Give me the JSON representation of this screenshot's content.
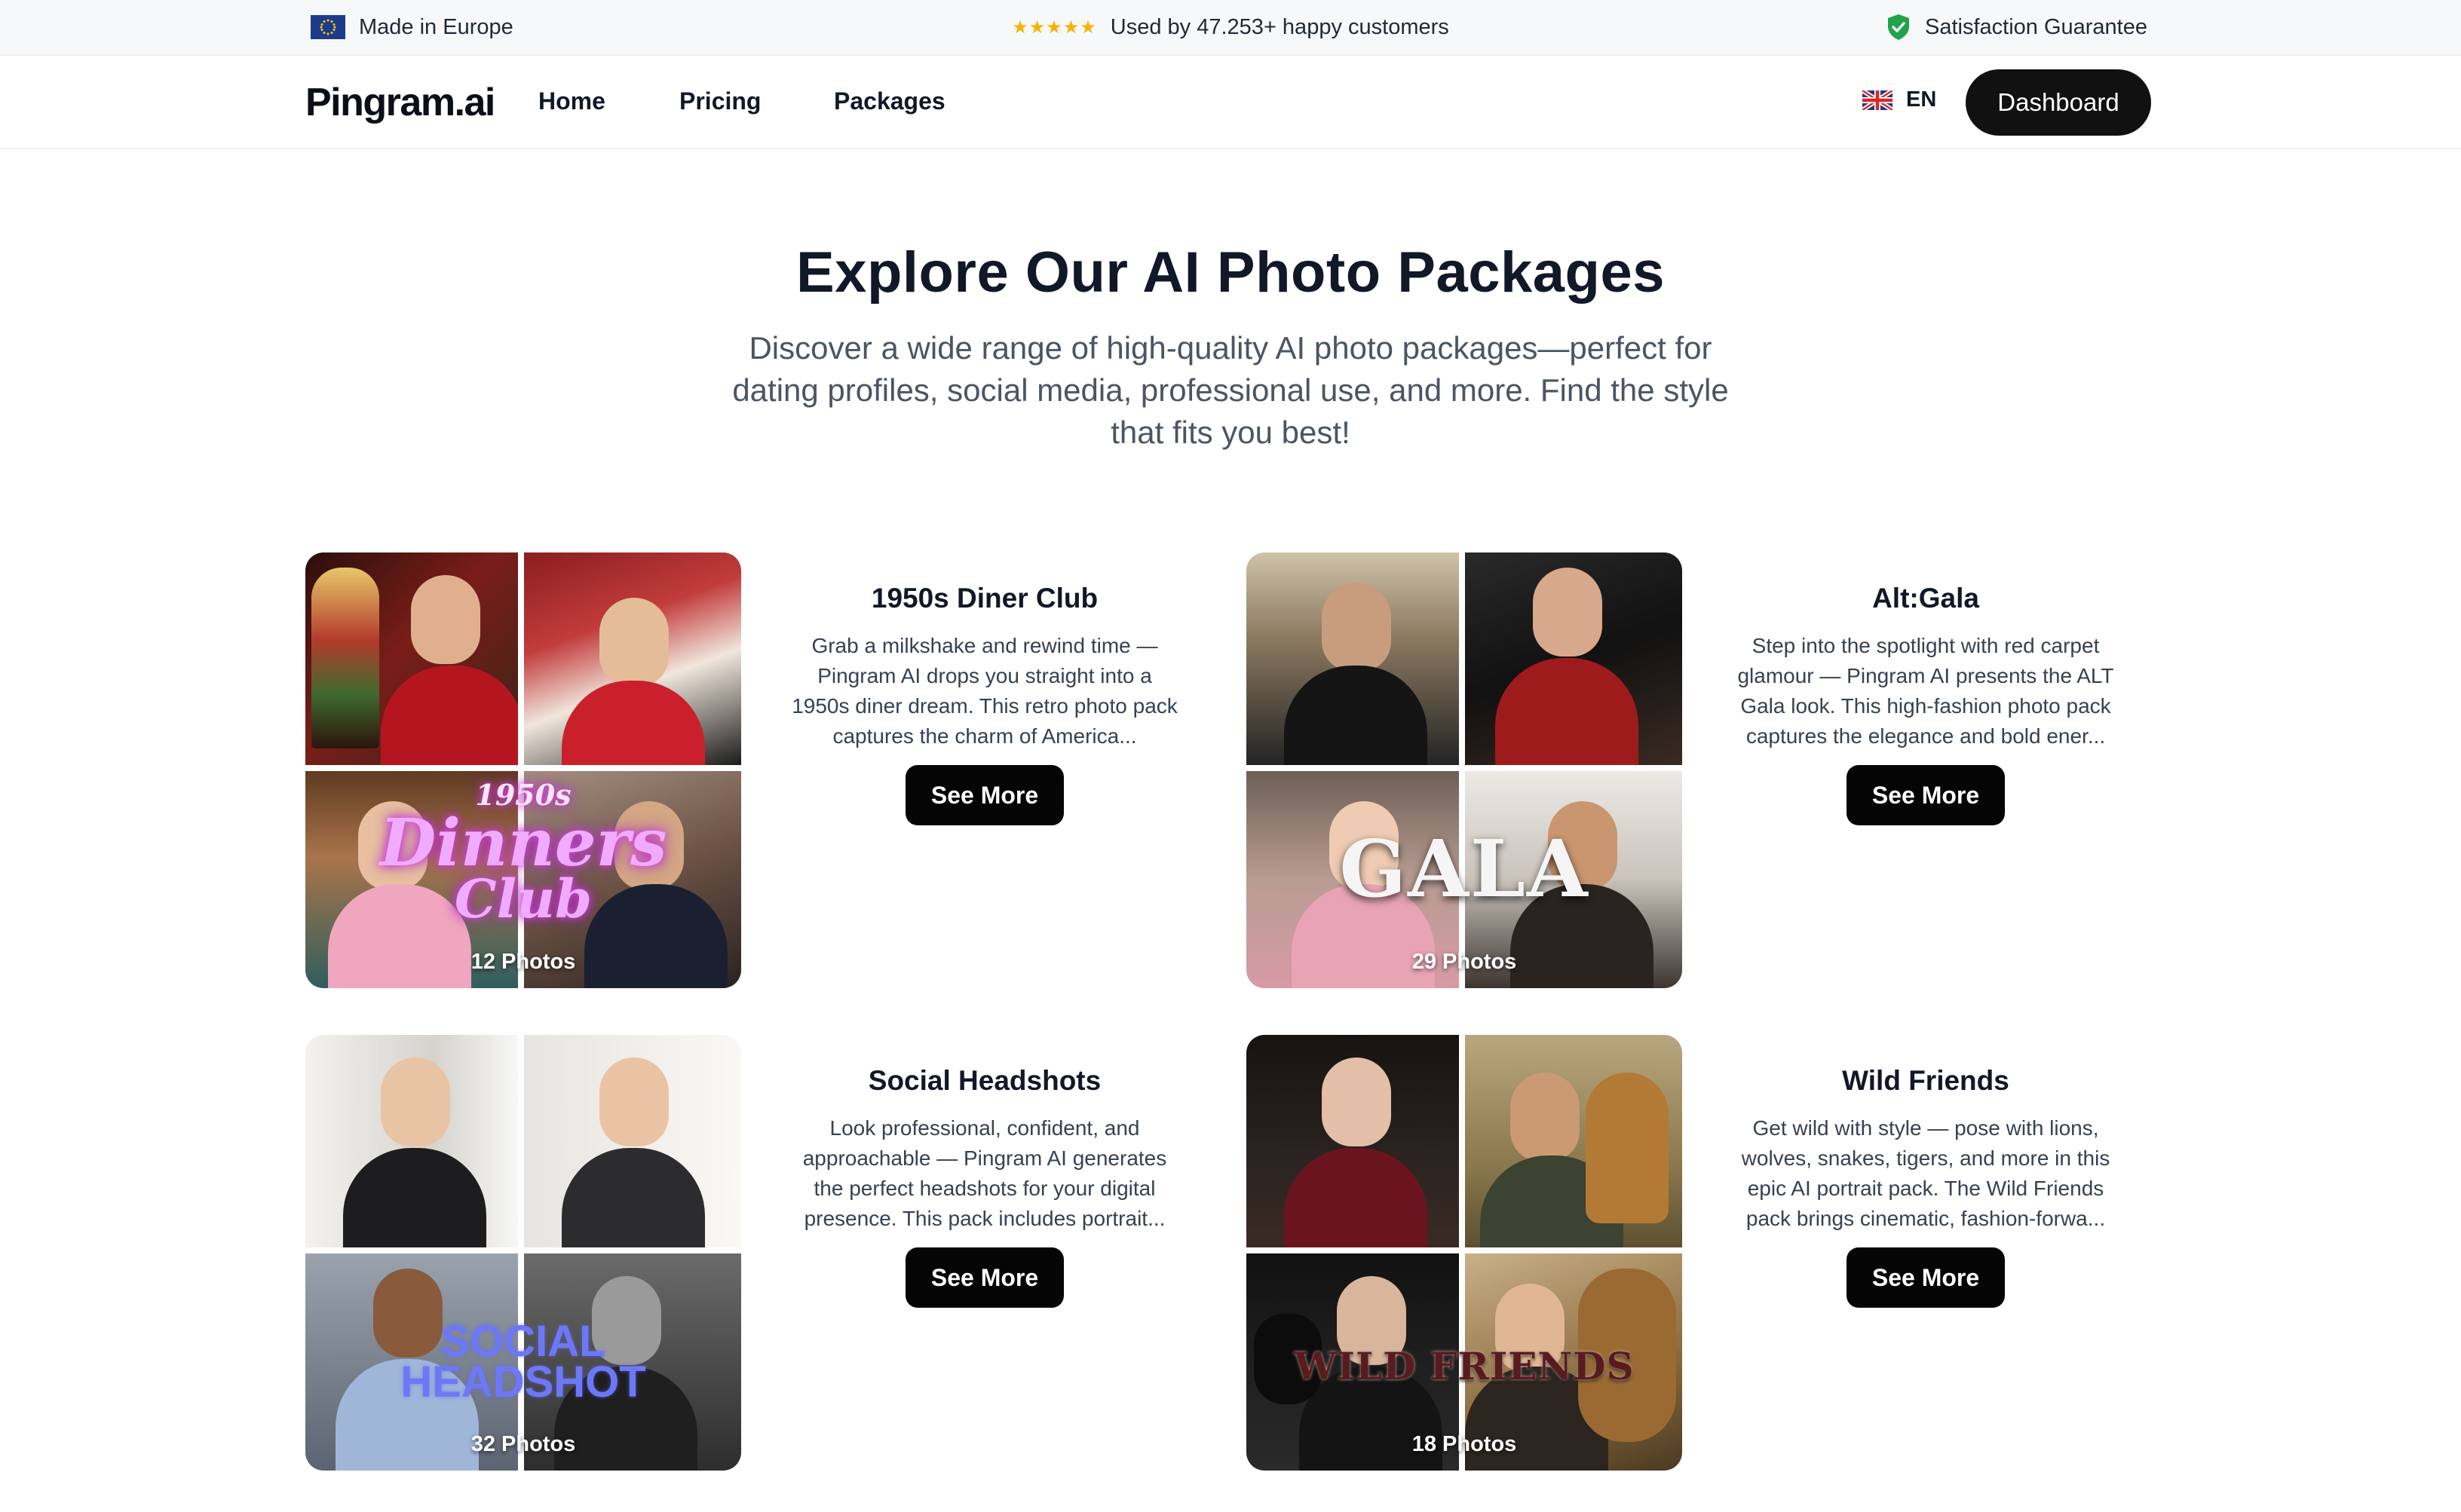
{
  "topbar": {
    "left_text": "Made in Europe",
    "left_icon": "eu-flag-icon",
    "rating_stars": "★★★★★",
    "middle_text": "Used by 47.253+ happy customers",
    "right_text": "Satisfaction Guarantee",
    "right_icon": "shield-check-icon"
  },
  "nav": {
    "logo": "Pingram.ai",
    "links": [
      "Home",
      "Pricing",
      "Packages"
    ],
    "language": "EN",
    "language_icon": "uk-flag-icon",
    "dashboard_label": "Dashboard"
  },
  "hero": {
    "title": "Explore Our AI Photo Packages",
    "subtitle": "Discover a wide range of high-quality AI photo packages—perfect for dating profiles, social media, professional use, and more. Find the style that fits you best!"
  },
  "packages": [
    {
      "title": "1950s Diner Club",
      "description": "Grab a milkshake and rewind time — Pingram AI drops you straight into a 1950s diner dream. This retro photo pack captures the charm of America...",
      "photo_count": "12 Photos",
      "overlay_lines": [
        "1950s",
        "Dinners",
        "Club"
      ],
      "button": "See More",
      "accent": "#d946ef"
    },
    {
      "title": "Alt:Gala",
      "description": "Step into the spotlight with red carpet glamour — Pingram AI presents the ALT Gala look. This high-fashion photo pack captures the elegance and bold ener...",
      "photo_count": "29 Photos",
      "overlay_lines": [
        "GALA"
      ],
      "button": "See More",
      "accent": "#e5e7eb"
    },
    {
      "title": "Social Headshots",
      "description": "Look professional, confident, and approachable — Pingram AI generates the perfect headshots for your digital presence. This pack includes portrait...",
      "photo_count": "32 Photos",
      "overlay_lines": [
        "SOCIAL",
        "HEADSHOT"
      ],
      "button": "See More",
      "accent": "#6366f1"
    },
    {
      "title": "Wild Friends",
      "description": "Get wild with style — pose with lions, wolves, snakes, tigers, and more in this epic AI portrait pack. The Wild Friends pack brings cinematic, fashion-forwa...",
      "photo_count": "18 Photos",
      "overlay_lines": [
        "WILD FRIENDS"
      ],
      "button": "See More",
      "accent": "#7f1d1d"
    }
  ]
}
